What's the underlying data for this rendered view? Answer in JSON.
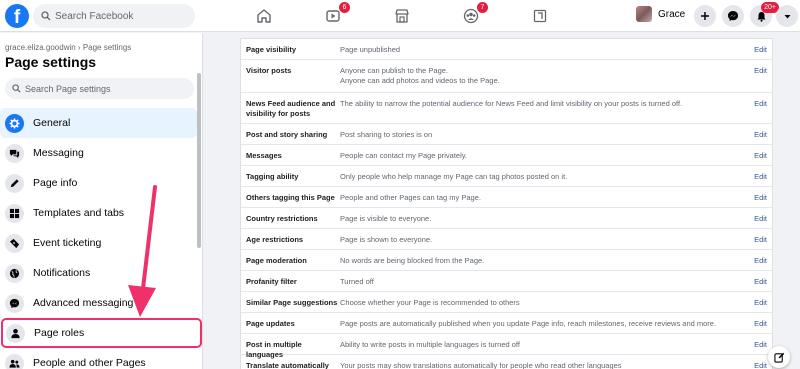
{
  "topbar": {
    "logo": "f",
    "search_placeholder": "Search Facebook",
    "watch_badge": "6",
    "groups_badge": "7",
    "profile_name": "Grace",
    "notifications_badge": "20+"
  },
  "sidebar": {
    "breadcrumb": "grace.eliza.goodwin › Page settings",
    "title": "Page settings",
    "search_placeholder": "Search Page settings",
    "items": [
      {
        "label": "General",
        "icon": "gear-icon"
      },
      {
        "label": "Messaging",
        "icon": "chat-icon"
      },
      {
        "label": "Page info",
        "icon": "pencil-icon"
      },
      {
        "label": "Templates and tabs",
        "icon": "grid-icon"
      },
      {
        "label": "Event ticketing",
        "icon": "ticket-icon"
      },
      {
        "label": "Notifications",
        "icon": "globe-icon"
      },
      {
        "label": "Advanced messaging",
        "icon": "messenger-icon"
      },
      {
        "label": "Page roles",
        "icon": "person-icon"
      },
      {
        "label": "People and other Pages",
        "icon": "people-icon"
      }
    ]
  },
  "settings": {
    "edit_label": "Edit",
    "rows": [
      {
        "title": "Page visibility",
        "desc": "Page unpublished"
      },
      {
        "title": "Visitor posts",
        "desc": "Anyone can publish to the Page.\nAnyone can add photos and videos to the Page."
      },
      {
        "title": "News Feed audience and visibility for posts",
        "desc": "The ability to narrow the potential audience for News Feed and limit visibility on your posts is turned off."
      },
      {
        "title": "Post and story sharing",
        "desc": "Post sharing to stories is on"
      },
      {
        "title": "Messages",
        "desc": "People can contact my Page privately."
      },
      {
        "title": "Tagging ability",
        "desc": "Only people who help manage my Page can tag photos posted on it."
      },
      {
        "title": "Others tagging this Page",
        "desc": "People and other Pages can tag my Page."
      },
      {
        "title": "Country restrictions",
        "desc": "Page is visible to everyone."
      },
      {
        "title": "Age restrictions",
        "desc": "Page is shown to everyone."
      },
      {
        "title": "Page moderation",
        "desc": "No words are being blocked from the Page."
      },
      {
        "title": "Profanity filter",
        "desc": "Turned off"
      },
      {
        "title": "Similar Page suggestions",
        "desc": "Choose whether your Page is recommended to others"
      },
      {
        "title": "Page updates",
        "desc": "Page posts are automatically published when you update Page info, reach milestones, receive reviews and more."
      },
      {
        "title": "Post in multiple languages",
        "desc": "Ability to write posts in multiple languages is turned off"
      },
      {
        "title": "Translate automatically",
        "desc": "Your posts may show translations automatically for people who read other languages"
      }
    ]
  },
  "colors": {
    "brand": "#1877f2",
    "highlight": "#f0306b",
    "link": "#385898",
    "badge": "#e41e3f"
  }
}
